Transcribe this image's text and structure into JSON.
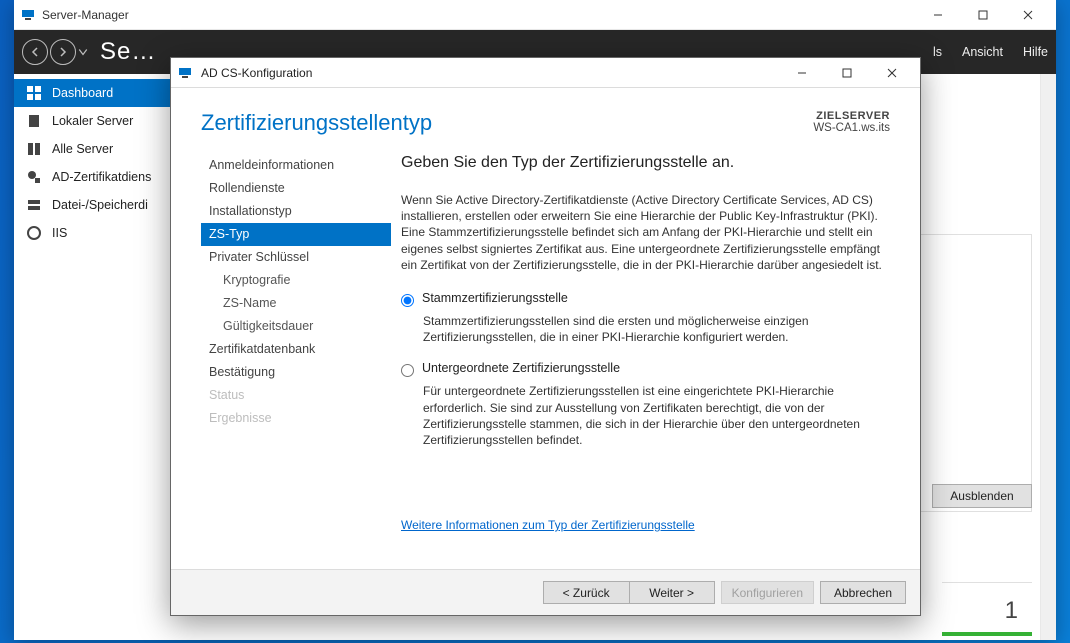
{
  "main": {
    "title": "Server-Manager",
    "crumb": "Se…",
    "menu_partial1": "ls",
    "menu_ansicht": "Ansicht",
    "menu_hilfe": "Hilfe",
    "sidebar": [
      {
        "label": "Dashboard"
      },
      {
        "label": "Lokaler Server"
      },
      {
        "label": "Alle Server"
      },
      {
        "label": "AD-Zertifikatdiens"
      },
      {
        "label": "Datei-/Speicherdi"
      },
      {
        "label": "IIS"
      }
    ],
    "ausblenden": "Ausblenden",
    "one": "1"
  },
  "dialog": {
    "title": "AD CS-Konfiguration",
    "heading": "Zertifizierungsstellentyp",
    "target_label": "ZIELSERVER",
    "target_server": "WS-CA1.ws.its",
    "nav": [
      {
        "label": "Anmeldeinformationen",
        "cls": ""
      },
      {
        "label": "Rollendienste",
        "cls": ""
      },
      {
        "label": "Installationstyp",
        "cls": ""
      },
      {
        "label": "ZS-Typ",
        "cls": "sel"
      },
      {
        "label": "Privater Schlüssel",
        "cls": ""
      },
      {
        "label": "Kryptografie",
        "cls": "sub"
      },
      {
        "label": "ZS-Name",
        "cls": "sub"
      },
      {
        "label": "Gültigkeitsdauer",
        "cls": "sub"
      },
      {
        "label": "Zertifikatdatenbank",
        "cls": ""
      },
      {
        "label": "Bestätigung",
        "cls": ""
      },
      {
        "label": "Status",
        "cls": "dis"
      },
      {
        "label": "Ergebnisse",
        "cls": "dis"
      }
    ],
    "pane": {
      "subtitle": "Geben Sie den Typ der Zertifizierungsstelle an.",
      "intro": "Wenn Sie Active Directory-Zertifikatdienste (Active Directory Certificate Services, AD CS) installieren, erstellen oder erweitern Sie eine Hierarchie der Public Key-Infrastruktur (PKI). Eine Stammzertifizierungsstelle befindet sich am Anfang der PKI-Hierarchie und stellt ein eigenes selbst signiertes Zertifikat aus. Eine untergeordnete Zertifizierungsstelle empfängt ein Zertifikat von der Zertifizierungsstelle, die in der PKI-Hierarchie darüber angesiedelt ist.",
      "opt1_label": "Stammzertifizierungsstelle",
      "opt1_desc": "Stammzertifizierungsstellen sind die ersten und möglicherweise einzigen Zertifizierungsstellen, die in einer PKI-Hierarchie konfiguriert werden.",
      "opt2_label": "Untergeordnete Zertifizierungsstelle",
      "opt2_desc": "Für untergeordnete Zertifizierungsstellen ist eine eingerichtete PKI-Hierarchie erforderlich. Sie sind zur Ausstellung von Zertifikaten berechtigt, die von der Zertifizierungsstelle stammen, die sich in der Hierarchie über den untergeordneten Zertifizierungsstellen befindet.",
      "more_link": "Weitere Informationen zum Typ der Zertifizierungsstelle"
    },
    "buttons": {
      "back": "< Zurück",
      "next": "Weiter >",
      "configure": "Konfigurieren",
      "cancel": "Abbrechen"
    }
  }
}
